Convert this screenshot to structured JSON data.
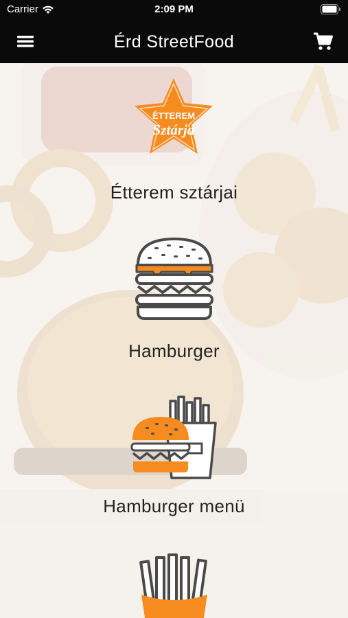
{
  "status": {
    "carrier": "Carrier",
    "time": "2:09 PM"
  },
  "nav": {
    "title": "Érd StreetFood"
  },
  "categories": [
    {
      "label": "Étterem sztárjai",
      "badge_line1": "ÉTTEREM",
      "badge_line2": "Sztárja",
      "icon": "star-badge-icon"
    },
    {
      "label": "Hamburger",
      "icon": "hamburger-icon"
    },
    {
      "label": "Hamburger menü",
      "icon": "burger-fries-menu-icon"
    },
    {
      "label": "",
      "icon": "fries-icon"
    }
  ],
  "colors": {
    "accent": "#f68b1f",
    "bar": "#0a0a0a",
    "outline": "#4a4a4a"
  }
}
